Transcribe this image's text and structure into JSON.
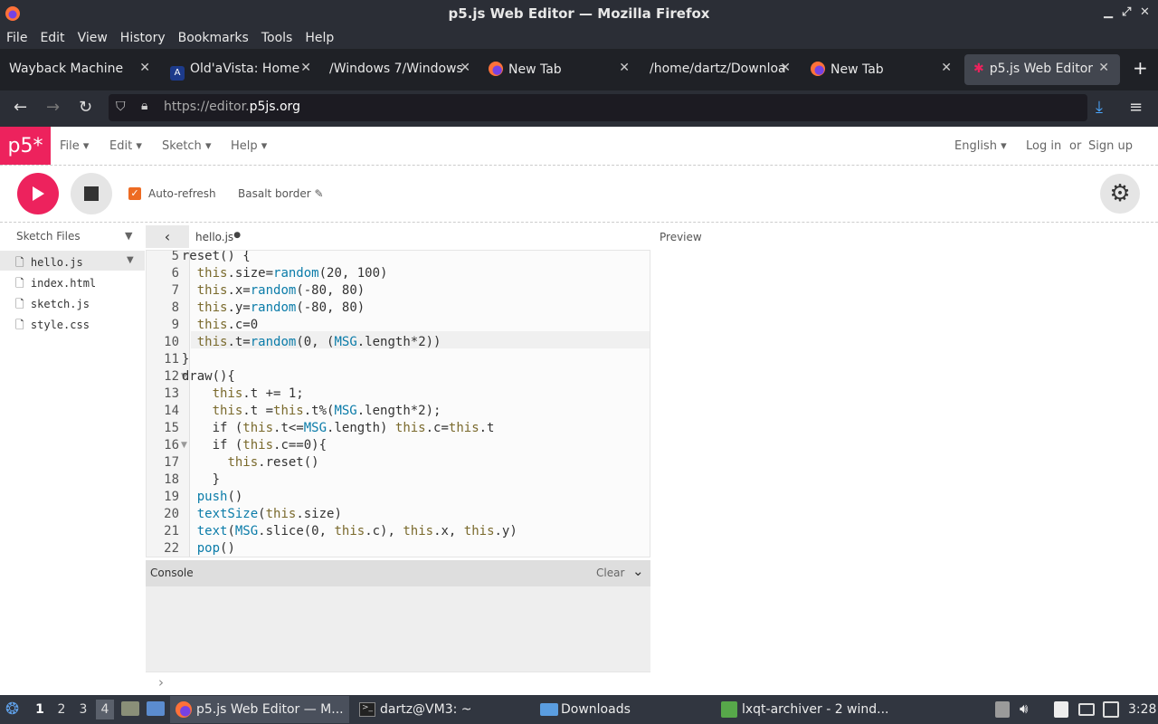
{
  "window": {
    "title": "p5.js Web Editor — Mozilla Firefox"
  },
  "menubar": [
    "File",
    "Edit",
    "View",
    "History",
    "Bookmarks",
    "Tools",
    "Help"
  ],
  "tabs": [
    {
      "label": "Wayback Machine",
      "icon": "none"
    },
    {
      "label": "Old'aVista: Home",
      "icon": "altavista-icon"
    },
    {
      "label": "/Windows 7/Windows",
      "icon": "none"
    },
    {
      "label": "New Tab",
      "icon": "firefox-icon"
    },
    {
      "label": "/home/dartz/Downloa",
      "icon": "none"
    },
    {
      "label": "New Tab",
      "icon": "firefox-icon"
    },
    {
      "label": "p5.js Web Editor",
      "icon": "p5-asterisk-icon",
      "active": true
    }
  ],
  "address": {
    "prefix": "https://editor.",
    "domain": "p5js.org"
  },
  "p5": {
    "logo": "p5*",
    "nav": [
      "File",
      "Edit",
      "Sketch",
      "Help"
    ],
    "language": "English",
    "login": "Log in",
    "or": "or",
    "signup": "Sign up",
    "auto_refresh": "Auto-refresh",
    "sketch_name": "Basalt border",
    "sketch_files": "Sketch Files",
    "files": [
      "hello.js",
      "index.html",
      "sketch.js",
      "style.css"
    ],
    "active_file": "hello.js",
    "tab_name": "hello.js",
    "preview": "Preview",
    "console": "Console",
    "clear": "Clear",
    "console_prompt": "›"
  },
  "code": {
    "lines": [
      {
        "n": "5",
        "text": "  reset() {"
      },
      {
        "n": "6",
        "text": "    this.size=random(20, 100)"
      },
      {
        "n": "7",
        "text": "    this.x=random(-80, 80)"
      },
      {
        "n": "8",
        "text": "    this.y=random(-80, 80)"
      },
      {
        "n": "9",
        "text": "    this.c=0"
      },
      {
        "n": "10",
        "text": "    this.t=random(0, (MSG.length*2))"
      },
      {
        "n": "11",
        "text": "  }"
      },
      {
        "n": "12",
        "text": "  draw(){"
      },
      {
        "n": "13",
        "text": "      this.t += 1;"
      },
      {
        "n": "14",
        "text": "      this.t =this.t%(MSG.length*2);"
      },
      {
        "n": "15",
        "text": "      if (this.t<=MSG.length) this.c=this.t"
      },
      {
        "n": "16",
        "text": "      if (this.c==0){"
      },
      {
        "n": "17",
        "text": "        this.reset()"
      },
      {
        "n": "18",
        "text": "      }"
      },
      {
        "n": "19",
        "text": "    push()"
      },
      {
        "n": "20",
        "text": "    textSize(this.size)"
      },
      {
        "n": "21",
        "text": "    text(MSG.slice(0, this.c), this.x, this.y)"
      },
      {
        "n": "22",
        "text": "    pop()"
      }
    ]
  },
  "taskbar": {
    "workspaces": [
      "1",
      "2",
      "3",
      "4"
    ],
    "tasks": [
      "p5.js Web Editor — M...",
      "dartz@VM3: ~",
      "Downloads",
      "lxqt-archiver - 2 wind..."
    ],
    "clock": "3:28"
  },
  "colors": {
    "accent": "#ed225d",
    "checkbox": "#ed6b23",
    "chrome": "#2b2e36"
  }
}
